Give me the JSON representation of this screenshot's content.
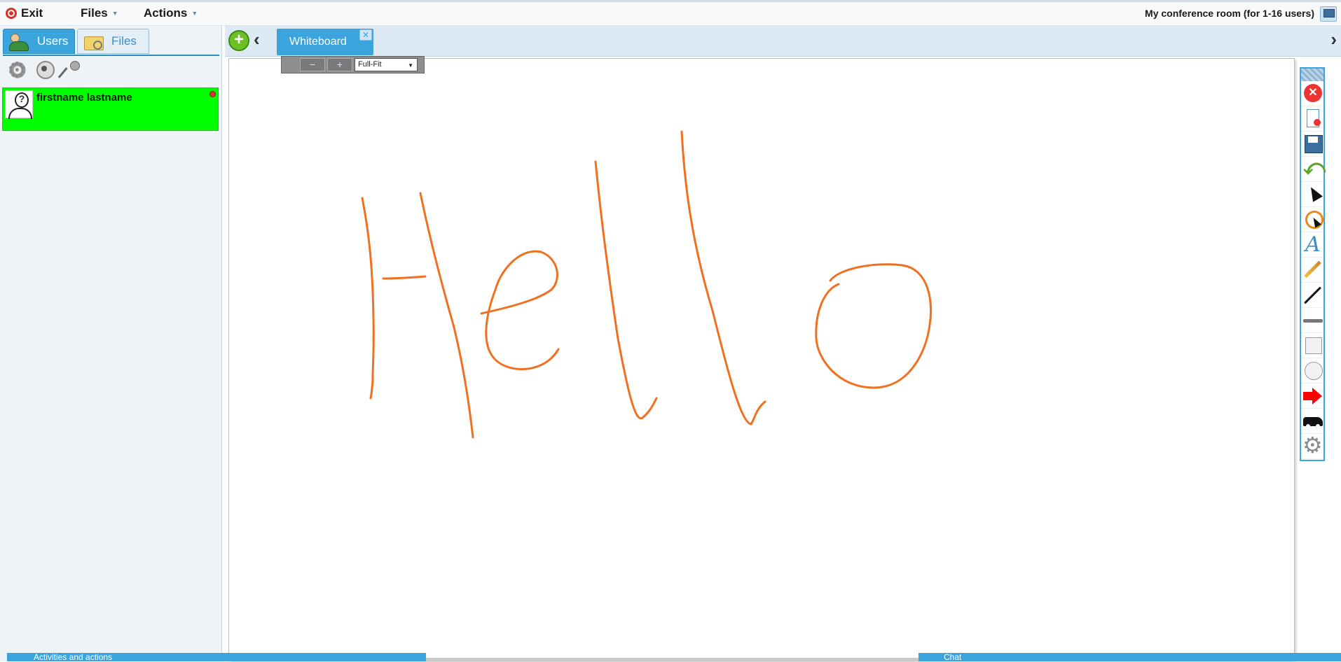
{
  "topbar": {
    "exit_label": "Exit",
    "files_label": "Files",
    "actions_label": "Actions",
    "room_title": "My conference room (for 1-16 users)"
  },
  "leftpanel": {
    "tabs": [
      {
        "label": "Users",
        "icon": "users-icon",
        "active": true
      },
      {
        "label": "Files",
        "icon": "folder-icon",
        "active": false
      }
    ],
    "tools": [
      "gear-icon",
      "webcam-icon",
      "microphone-icon"
    ],
    "user": {
      "name": "firstname lastname",
      "bg_color": "#00ff00"
    }
  },
  "whiteboard": {
    "tab_label": "Whiteboard",
    "close_glyph": "✕",
    "zoom_minus": "−",
    "zoom_plus": "+",
    "zoom_mode": "Full-Fit",
    "stroke_color": "#f07020"
  },
  "righttoolbar": {
    "tools": [
      "close-whiteboard-icon",
      "clear-page-icon",
      "save-icon",
      "undo-icon",
      "pointer-icon",
      "laser-pointer-icon",
      "text-icon",
      "brush-icon",
      "line-icon",
      "underline-icon",
      "rectangle-icon",
      "ellipse-icon",
      "arrow-icon",
      "clipart-icon",
      "settings-icon"
    ]
  },
  "bottom": {
    "activities_label": "Activities and actions",
    "chat_label": "Chat"
  },
  "colors": {
    "accent": "#3ba4dc",
    "add_button": "#6cc026"
  }
}
